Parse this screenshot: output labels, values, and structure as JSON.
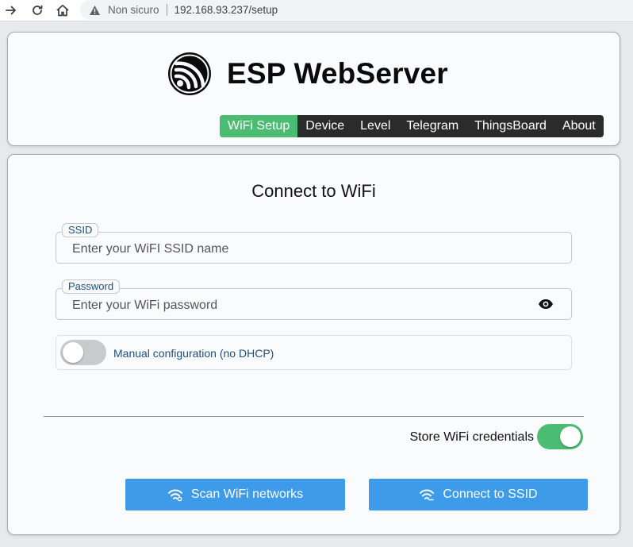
{
  "browser": {
    "security_text": "Non sicuro",
    "url": "192.168.93.237/setup",
    "icons": [
      "forward-icon",
      "reload-icon",
      "home-icon",
      "warning-icon"
    ]
  },
  "header": {
    "title": "ESP WebServer",
    "logo_icon": "espressif-logo-icon",
    "menu": [
      {
        "label": "WiFi Setup",
        "active": true
      },
      {
        "label": "Device",
        "active": false
      },
      {
        "label": "Level",
        "active": false
      },
      {
        "label": "Telegram",
        "active": false
      },
      {
        "label": "ThingsBoard",
        "active": false
      },
      {
        "label": "About",
        "active": false
      }
    ]
  },
  "form": {
    "title": "Connect to WiFi",
    "ssid": {
      "label": "SSID",
      "placeholder": "Enter your WiFI SSID name",
      "value": ""
    },
    "password": {
      "label": "Password",
      "placeholder": "Enter your WiFi password",
      "value": "",
      "reveal_icon": "eye-icon"
    },
    "manual_config": {
      "label": "Manual configuration (no DHCP)",
      "enabled": false
    },
    "store_credentials": {
      "label": "Store WiFi credentials",
      "enabled": true
    },
    "scan_button": {
      "label": "Scan WiFi networks",
      "icon": "wifi-search-icon"
    },
    "connect_button": {
      "label": "Connect to SSID",
      "icon": "wifi-connect-icon"
    }
  },
  "colors": {
    "accent_green": "#4cbc73",
    "button_blue": "#3d9be9",
    "menu_dark": "#2b2b2b",
    "label_blue": "#1f4e79"
  }
}
